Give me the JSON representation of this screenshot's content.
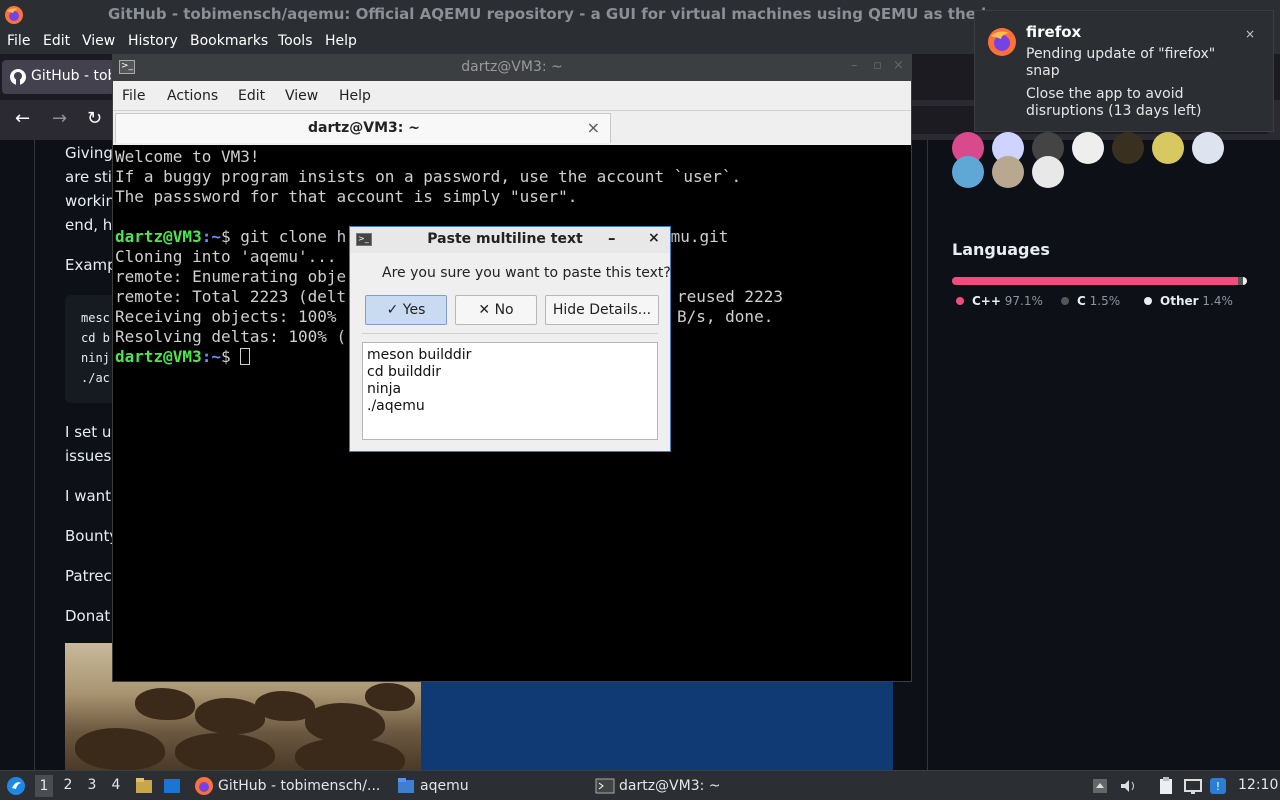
{
  "firefox": {
    "window_title": "GitHub - tobimensch/aqemu: Official AQEMU repository - a GUI for virtual machines using QEMU as the ba",
    "menu": [
      "File",
      "Edit",
      "View",
      "History",
      "Bookmarks",
      "Tools",
      "Help"
    ],
    "tab_label": "GitHub - tobi",
    "nav": {
      "back": "←",
      "forward": "→",
      "reload": "↻"
    }
  },
  "readme": {
    "lines": [
      "Giving",
      "are sti",
      "workin",
      "end, h",
      "Examp",
      "I set u",
      "issues",
      "I want",
      "Bounty",
      "Patrec",
      "Donat"
    ],
    "code_lines": [
      "mesc",
      "cd b",
      "ninj",
      "./ac"
    ]
  },
  "sidebar": {
    "languages_title": "Languages",
    "languages": [
      {
        "name": "C++",
        "percent": "97.1%",
        "value": 97.1,
        "color": "#f34b7d"
      },
      {
        "name": "C",
        "percent": "1.5%",
        "value": 1.5,
        "color": "#555555"
      },
      {
        "name": "Other",
        "percent": "1.4%",
        "value": 1.4,
        "color": "#ededed"
      }
    ]
  },
  "terminal": {
    "window_title": "dartz@VM3: ~",
    "menu": [
      "File",
      "Actions",
      "Edit",
      "View",
      "Help"
    ],
    "tab_label": "dartz@VM3: ~",
    "tab_close": "×",
    "lines": [
      "Welcome to VM3!",
      "If a buggy program insists on a password, use the account `user`.",
      "The passsword for that account is simply \"user\"."
    ],
    "prompt_user": "dartz@VM3",
    "prompt_path": ":~",
    "prompt_symbol": "$ ",
    "command": "git clone h",
    "command_tail": "emu.git",
    "output": [
      {
        "left": "Cloning into 'aqemu'...",
        "right": ""
      },
      {
        "left": "remote: Enumerating obje",
        "right": ""
      },
      {
        "left": "remote: Total 2223 (delt",
        "right": "reused 2223"
      },
      {
        "left": "Receiving objects: 100%",
        "right": "B/s, done."
      },
      {
        "left": "Resolving deltas: 100% (",
        "right": ""
      }
    ]
  },
  "dialog": {
    "title": "Paste multiline text",
    "minimize": "–",
    "close": "×",
    "question": "Are you sure you want to paste this text?",
    "yes_label": "Yes",
    "yes_icon": "✓",
    "no_label": "No",
    "no_icon": "✕",
    "details_label": "Hide Details...",
    "text_lines": [
      "meson builddir",
      "cd builddir",
      "ninja",
      "./aqemu"
    ]
  },
  "notification": {
    "app": "firefox",
    "close": "×",
    "line1": "Pending update of \"firefox\"",
    "line2": "snap",
    "line3": "Close the app to avoid",
    "line4": "disruptions (13 days left)"
  },
  "taskbar": {
    "workspaces": [
      "1",
      "2",
      "3",
      "4"
    ],
    "firefox_item": "GitHub - tobimensch/...",
    "folder_item": "aqemu",
    "terminal_item": "dartz@VM3: ~",
    "clock": "12:10"
  }
}
